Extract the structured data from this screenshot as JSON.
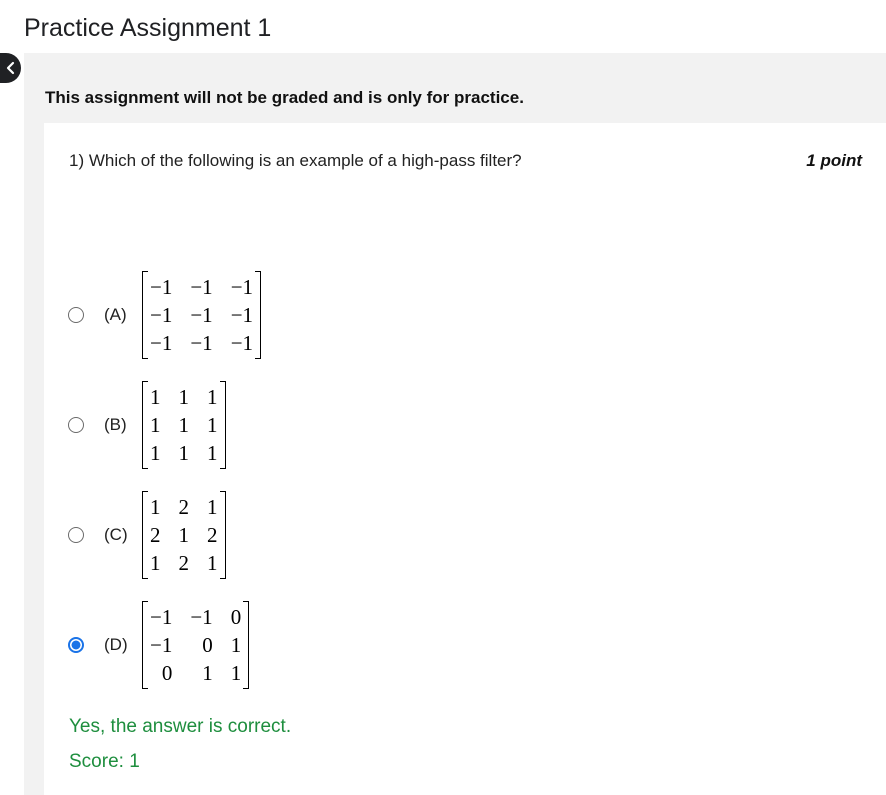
{
  "page": {
    "title": "Practice Assignment 1"
  },
  "notice": "This assignment will not be graded and is only for practice.",
  "question": {
    "text": "1) Which of the following is an example of a high-pass filter?",
    "points": "1 point",
    "options": [
      {
        "label": "(A)",
        "selected": false,
        "matrix": [
          [
            "−1",
            "−1",
            "−1"
          ],
          [
            "−1",
            "−1",
            "−1"
          ],
          [
            "−1",
            "−1",
            "−1"
          ]
        ]
      },
      {
        "label": "(B)",
        "selected": false,
        "matrix": [
          [
            "1",
            "1",
            "1"
          ],
          [
            "1",
            "1",
            "1"
          ],
          [
            "1",
            "1",
            "1"
          ]
        ]
      },
      {
        "label": "(C)",
        "selected": false,
        "matrix": [
          [
            "1",
            "2",
            "1"
          ],
          [
            "2",
            "1",
            "2"
          ],
          [
            "1",
            "2",
            "1"
          ]
        ]
      },
      {
        "label": "(D)",
        "selected": true,
        "matrix": [
          [
            "−1",
            "−1",
            "0"
          ],
          [
            "−1",
            "0",
            "1"
          ],
          [
            "0",
            "1",
            "1"
          ]
        ]
      }
    ]
  },
  "feedback": {
    "message": "Yes, the answer is correct.",
    "score": "Score: 1"
  },
  "colors": {
    "accent": "#1a73e8",
    "success": "#1e8e3e",
    "panel": "#f2f2f2"
  },
  "icons": {
    "back": "chevron-left-icon"
  }
}
